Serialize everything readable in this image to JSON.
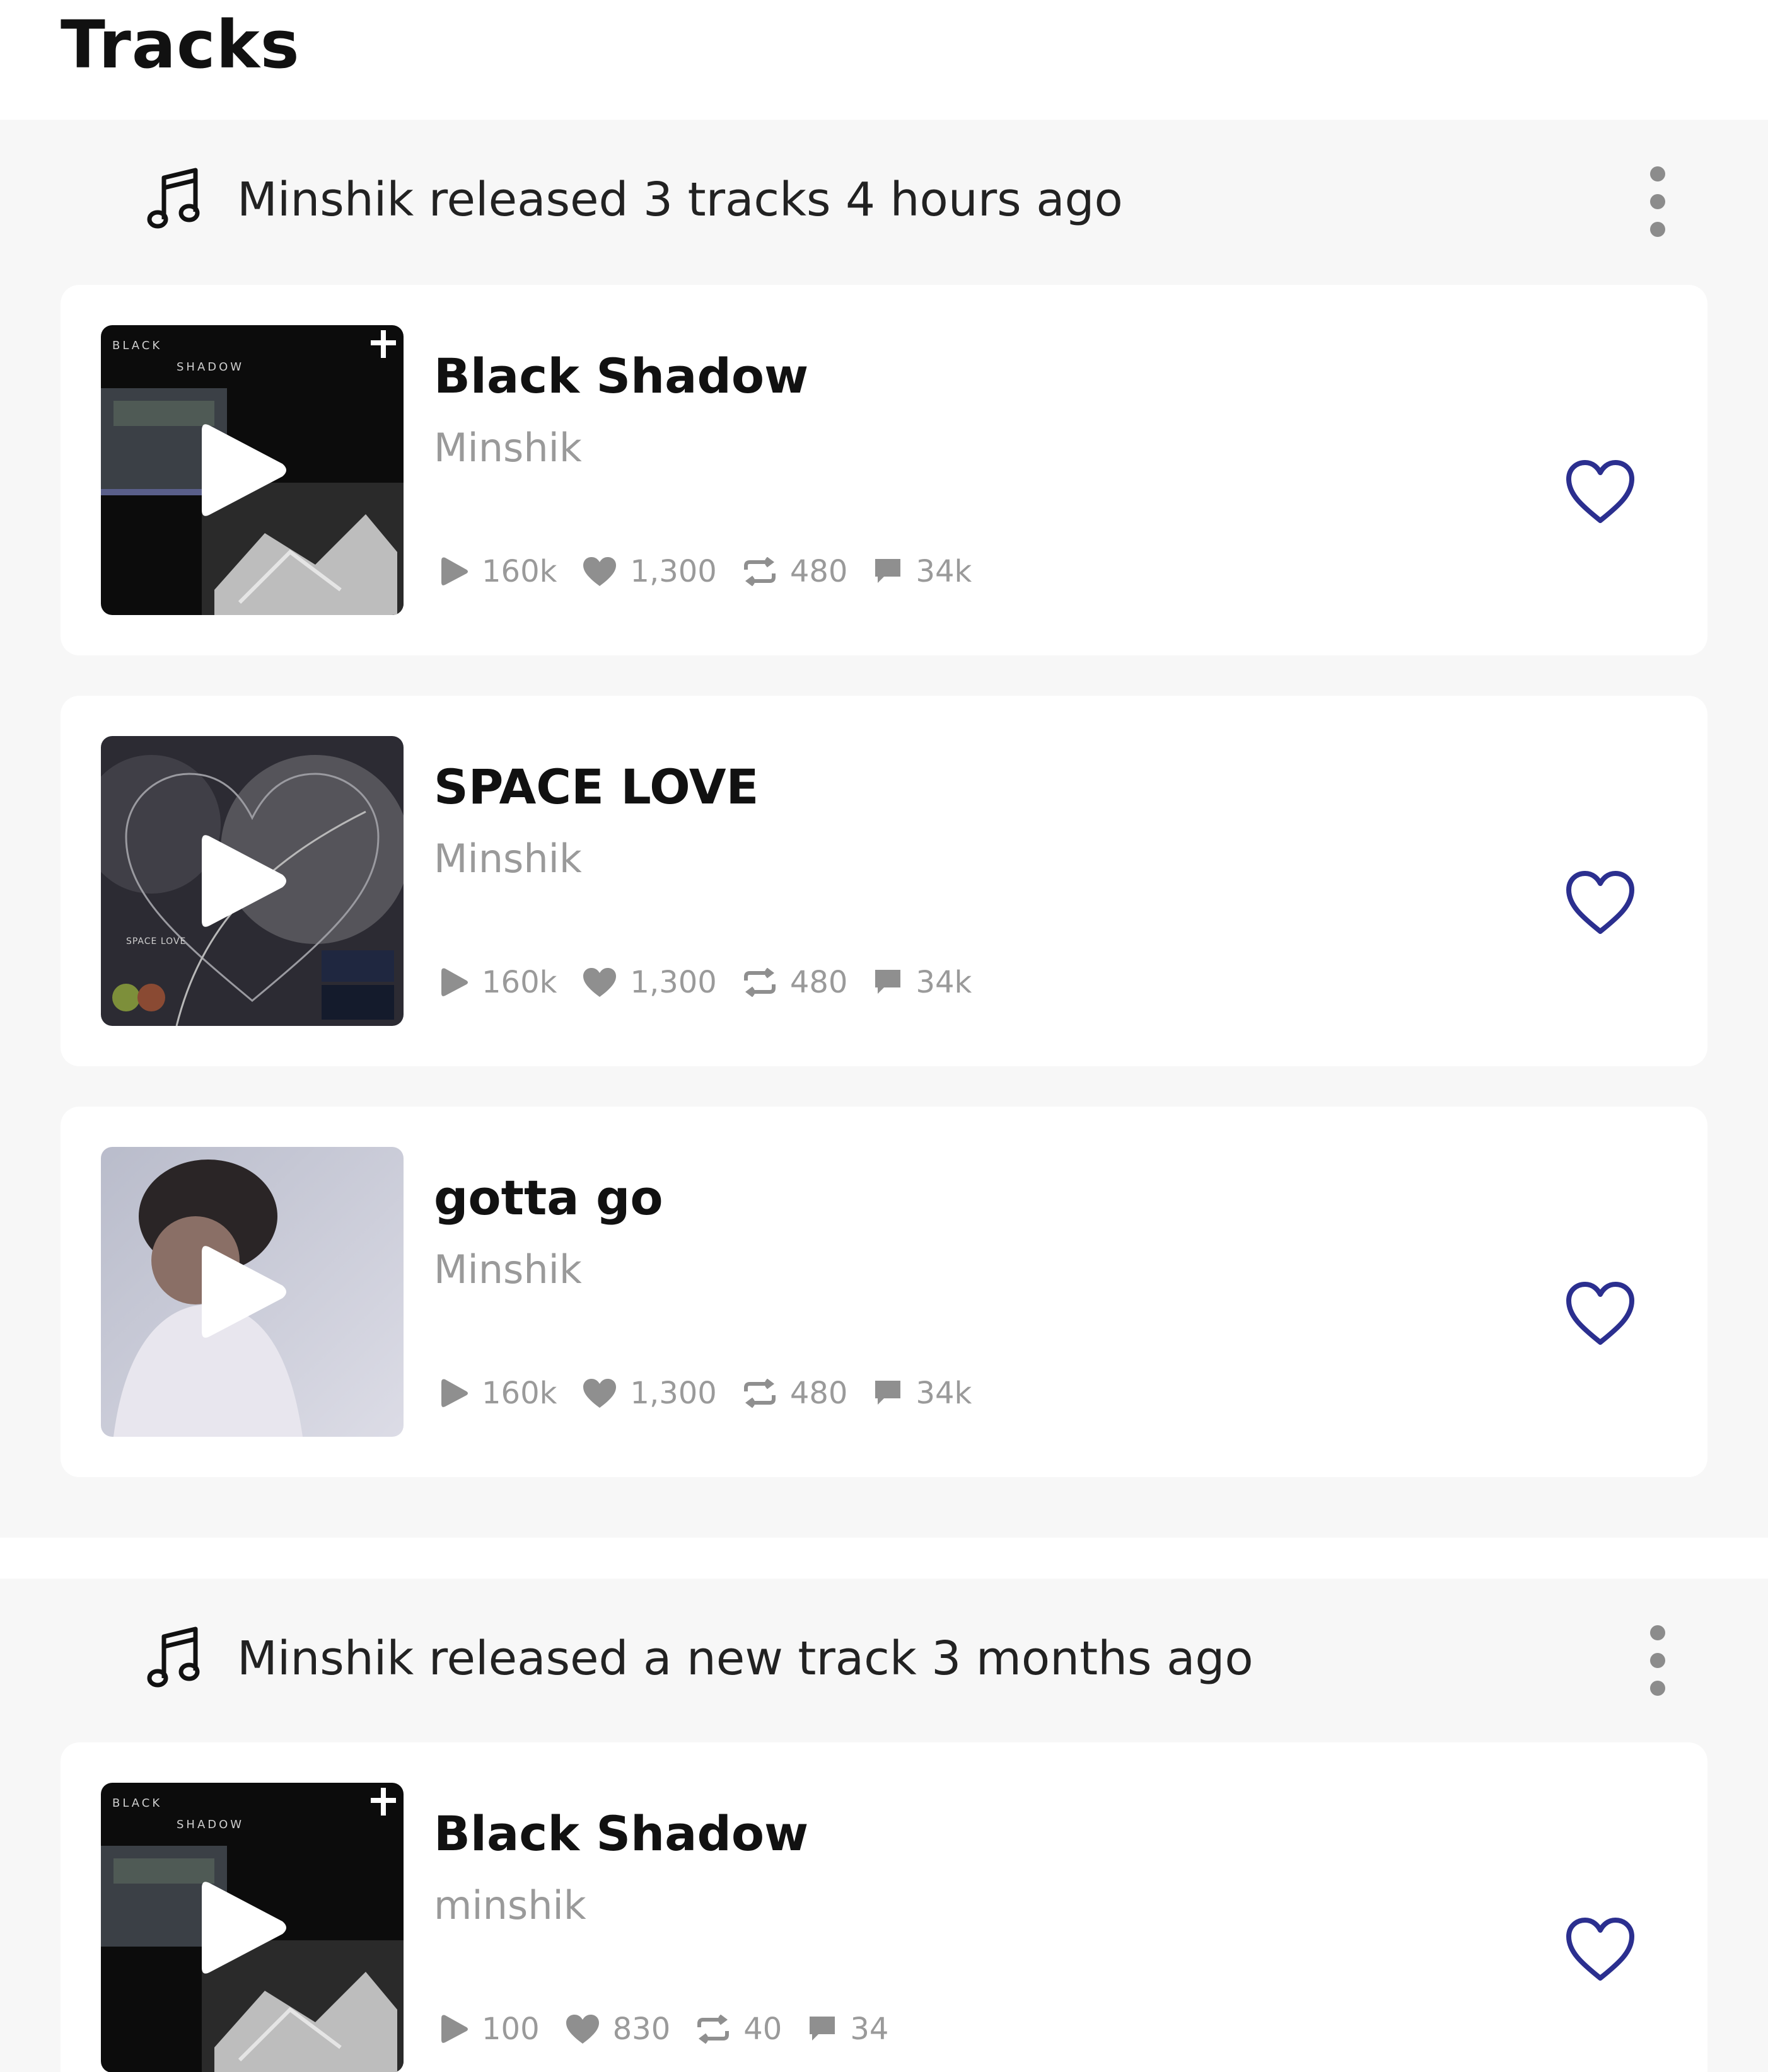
{
  "header": {
    "title": "Tracks"
  },
  "colors": {
    "accent": "#2b2f8f",
    "muted": "#9a9a9a",
    "background": "#f7f7f7"
  },
  "sections": [
    {
      "text": "Minshik released 3 tracks 4 hours ago",
      "icon": "music-note-icon",
      "tracks": [
        {
          "title": "Black Shadow",
          "artist": "Minshik",
          "plays": "160k",
          "likes": "1,300",
          "reposts": "480",
          "comments": "34k",
          "cover": "black-shadow",
          "cover_text": [
            "BLACK",
            "SHADOW"
          ]
        },
        {
          "title": "SPACE LOVE",
          "artist": "Minshik",
          "plays": "160k",
          "likes": "1,300",
          "reposts": "480",
          "comments": "34k",
          "cover": "space-love",
          "cover_text": [
            "SPACE LOVE"
          ]
        },
        {
          "title": "gotta go",
          "artist": "Minshik",
          "plays": "160k",
          "likes": "1,300",
          "reposts": "480",
          "comments": "34k",
          "cover": "gotta-go",
          "cover_text": []
        }
      ]
    },
    {
      "text": "Minshik released a new track 3 months ago",
      "icon": "music-note-icon",
      "tracks": [
        {
          "title": "Black Shadow",
          "artist": "minshik",
          "plays": "100",
          "likes": "830",
          "reposts": "40",
          "comments": "34",
          "cover": "black-shadow",
          "cover_text": [
            "BLACK",
            "SHADOW"
          ]
        }
      ]
    }
  ]
}
